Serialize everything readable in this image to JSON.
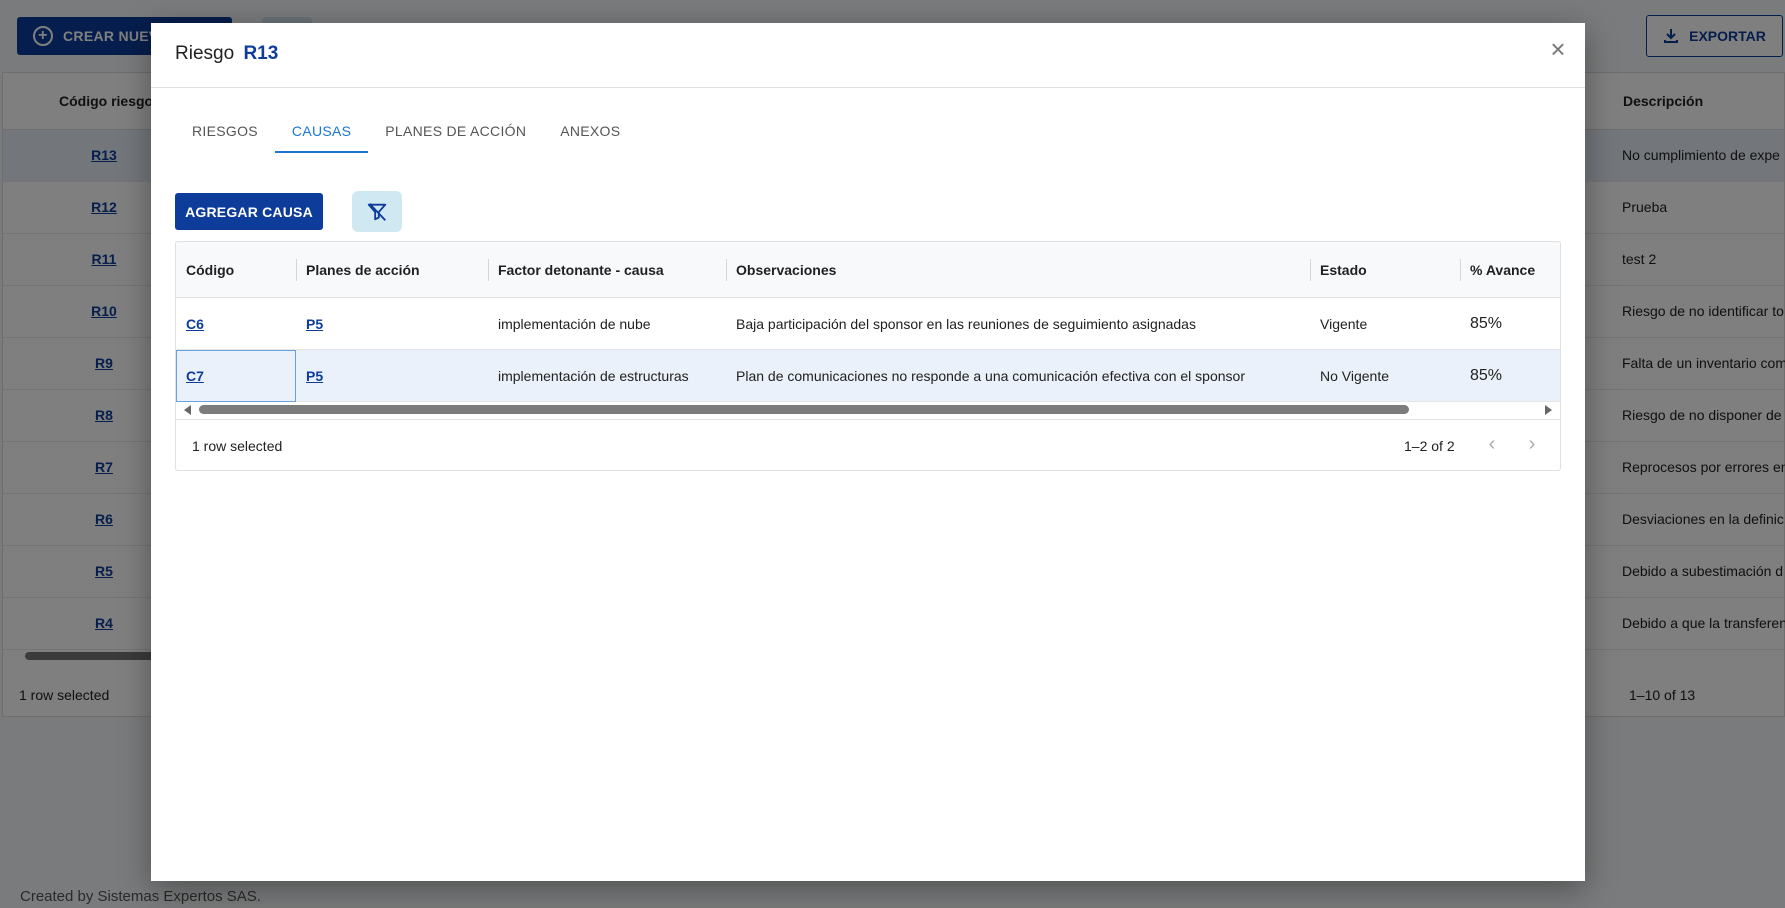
{
  "background": {
    "create_button": "CREAR NUEVO",
    "export_button": "EXPORTAR",
    "columns": {
      "code": "Código riesgo",
      "description": "Descripción"
    },
    "rows": [
      {
        "code": "R13",
        "description": "No cumplimiento de expe"
      },
      {
        "code": "R12",
        "description": "Prueba"
      },
      {
        "code": "R11",
        "description": "test 2"
      },
      {
        "code": "R10",
        "description": "Riesgo de no identificar to"
      },
      {
        "code": "R9",
        "description": "Falta de un inventario com"
      },
      {
        "code": "R8",
        "description": "Riesgo de no disponer de"
      },
      {
        "code": "R7",
        "description": "Reprocesos por errores en"
      },
      {
        "code": "R6",
        "description": "Desviaciones en la definic"
      },
      {
        "code": "R5",
        "description": "Debido a subestimación d"
      },
      {
        "code": "R4",
        "description": "Debido a que la transferen"
      }
    ],
    "selected_text": "1 row selected",
    "pagination": "1–10 of 13",
    "credit": "Created by Sistemas Expertos SAS."
  },
  "modal": {
    "title_prefix": "Riesgo",
    "title_code": "R13",
    "tabs": [
      "RIESGOS",
      "CAUSAS",
      "PLANES DE ACCIÓN",
      "ANEXOS"
    ],
    "active_tab": "CAUSAS",
    "add_button": "AGREGAR CAUSA",
    "columns": [
      "Código",
      "Planes de acción",
      "Factor detonante - causa",
      "Observaciones",
      "Estado",
      "% Avance"
    ],
    "rows": [
      {
        "code": "C6",
        "plan": "P5",
        "factor": "implementación de nube",
        "observations": "Baja participación del sponsor en las reuniones de seguimiento asignadas",
        "status": "Vigente",
        "progress": "85%"
      },
      {
        "code": "C7",
        "plan": "P5",
        "factor": "implementación de estructuras",
        "observations": "Plan de comunicaciones no responde a una comunicación efectiva con el sponsor",
        "status": "No Vigente",
        "progress": "85%"
      }
    ],
    "selected_text": "1 row selected",
    "pagination": "1–2 of 2"
  },
  "colors": {
    "primary": "#0d3c9a",
    "tab_active": "#1976d2",
    "selected_row": "#eaf1fa",
    "filter_bg": "#cfe8f2"
  }
}
